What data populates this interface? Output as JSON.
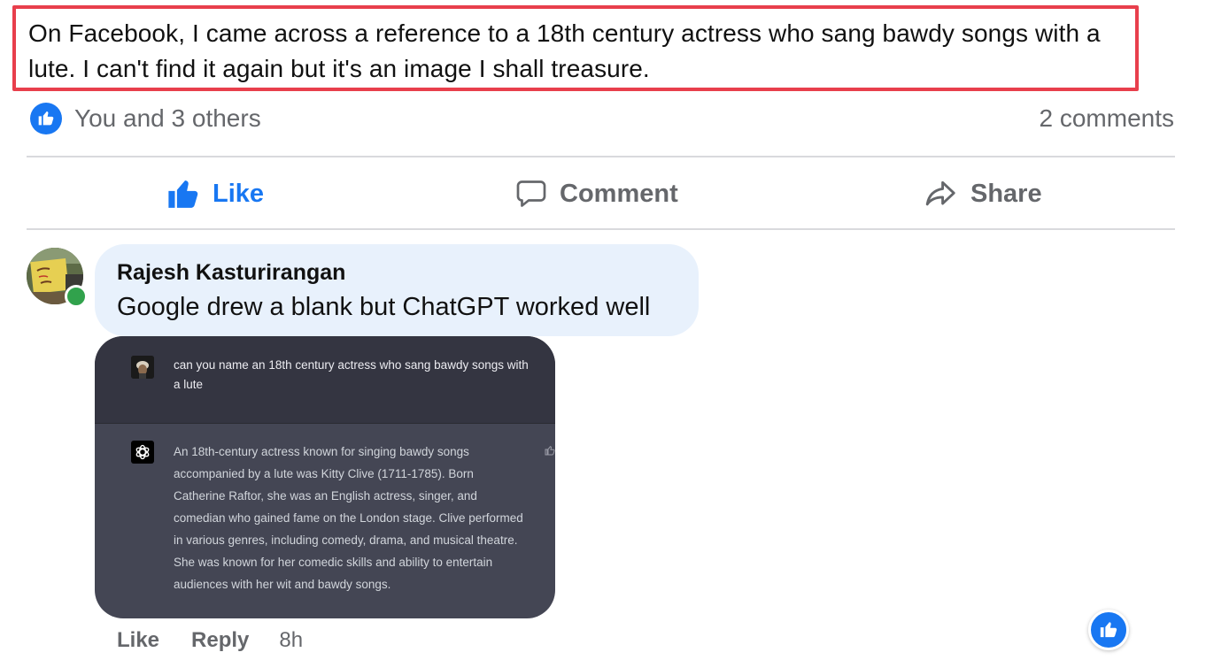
{
  "post": {
    "text": "On Facebook, I came across a reference to a 18th century actress who sang  bawdy songs with a lute. I can't find it again but it's an image I shall treasure."
  },
  "reactions": {
    "summary": "You and 3 others",
    "comments_count": "2 comments"
  },
  "actions": {
    "like_label": "Like",
    "comment_label": "Comment",
    "share_label": "Share"
  },
  "comment": {
    "author": "Rajesh Kasturirangan",
    "body": "Google drew a blank but ChatGPT worked well",
    "like_label": "Like",
    "reply_label": "Reply",
    "time": "8h"
  },
  "attachment": {
    "user_prompt": "can you name an 18th century actress who sang  bawdy songs with a lute",
    "assistant_reply": "An 18th-century actress known for singing bawdy songs accompanied by a lute was Kitty Clive (1711-1785). Born Catherine Raftor, she was an English actress, singer, and comedian who gained fame on the London stage. Clive performed in various genres, including comedy, drama, and musical theatre. She was known for her comedic skills and ability to entertain audiences with her wit and bawdy songs."
  },
  "colors": {
    "accent": "#1877f2",
    "highlight_border": "#e83f4c",
    "bubble_bg": "#e8f1fc",
    "online": "#31a24c"
  },
  "icons": {
    "like": "thumbs-up-icon",
    "comment": "speech-bubble-icon",
    "share": "share-arrow-icon",
    "chatgpt": "openai-logo-icon"
  }
}
